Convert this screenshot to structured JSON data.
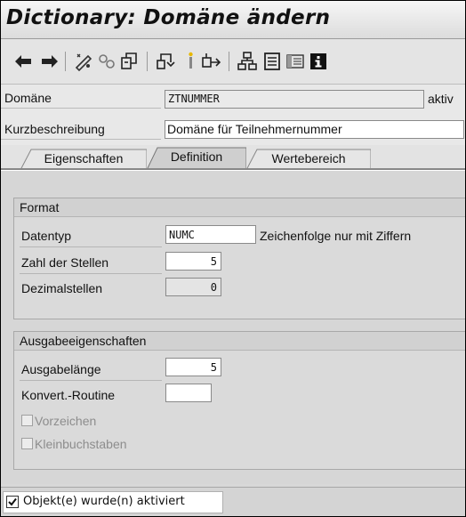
{
  "window": {
    "title": "Dictionary: Domäne ändern"
  },
  "toolbar": {
    "icons": [
      "back-arrow-icon",
      "forward-arrow-icon",
      "other-object-icon",
      "display-change-icon",
      "activate-icon",
      "where-used-icon",
      "object-list-icon",
      "navigation-icon",
      "hierarchy-icon",
      "text-icon",
      "list-icon",
      "info-icon"
    ]
  },
  "header": {
    "domain_label": "Domäne",
    "domain_value": "ZTNUMMER",
    "status": "aktiv",
    "short_desc_label": "Kurzbeschreibung",
    "short_desc_value": "Domäne für Teilnehmernummer"
  },
  "tabs": [
    {
      "label": "Eigenschaften",
      "active": false
    },
    {
      "label": "Definition",
      "active": true
    },
    {
      "label": "Wertebereich",
      "active": false
    }
  ],
  "format": {
    "title": "Format",
    "datatype_label": "Datentyp",
    "datatype_value": "NUMC",
    "datatype_desc": "Zeichenfolge nur mit Ziffern",
    "length_label": "Zahl der Stellen",
    "length_value": "5",
    "decimals_label": "Dezimalstellen",
    "decimals_value": "0"
  },
  "output": {
    "title": "Ausgabeeigenschaften",
    "output_length_label": "Ausgabelänge",
    "output_length_value": "5",
    "conversion_label": "Konvert.-Routine",
    "conversion_value": "",
    "sign_label": "Vorzeichen",
    "lowercase_label": "Kleinbuchstaben"
  },
  "status_bar": {
    "message": "Objekt(e) wurde(n) aktiviert"
  },
  "colors": {
    "accent": "#f0c000",
    "frame": "#d8d8d8"
  }
}
